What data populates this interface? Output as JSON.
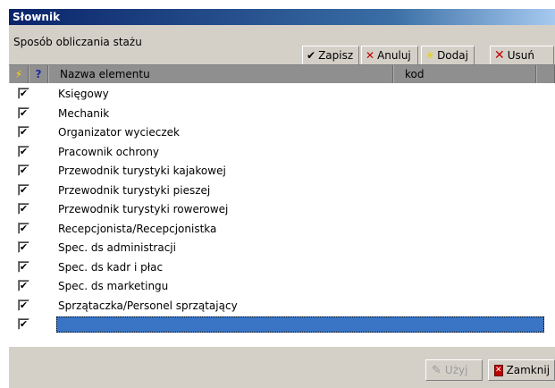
{
  "window": {
    "title": "Słownik"
  },
  "toolbar": {
    "label": "Sposób obliczania stażu",
    "buttons": [
      {
        "label": "Zapisz",
        "icon": "check-icon"
      },
      {
        "label": "Anuluj",
        "icon": "cross-icon"
      },
      {
        "label": "Dodaj",
        "icon": "star-icon"
      },
      {
        "label": "Usuń",
        "icon": "delete-x-icon"
      }
    ]
  },
  "grid": {
    "header": {
      "flag_icon": "lightning-icon",
      "help_icon": "?",
      "col_name": "Nazwa elementu",
      "col_code": "kod"
    },
    "rows": [
      {
        "checked": true,
        "name": "Księgowy"
      },
      {
        "checked": true,
        "name": "Mechanik"
      },
      {
        "checked": true,
        "name": "Organizator wycieczek"
      },
      {
        "checked": true,
        "name": "Pracownik ochrony"
      },
      {
        "checked": true,
        "name": "Przewodnik turystyki kajakowej"
      },
      {
        "checked": true,
        "name": "Przewodnik turystyki pieszej"
      },
      {
        "checked": true,
        "name": "Przewodnik turystyki rowerowej"
      },
      {
        "checked": true,
        "name": "Recepcjonista/Recepcjonistka"
      },
      {
        "checked": true,
        "name": "Spec. ds administracji"
      },
      {
        "checked": true,
        "name": "Spec. ds kadr i płac"
      },
      {
        "checked": true,
        "name": "Spec. ds marketingu"
      },
      {
        "checked": true,
        "name": "Sprzątaczka/Personel sprzątający"
      },
      {
        "checked": true,
        "name": ""
      }
    ],
    "selected_row": 12
  },
  "bottom": {
    "use_label": "Użyj",
    "close_label": "Zamknij"
  },
  "colors": {
    "title_start": "#0a246a",
    "selection": "#3a74c4",
    "face": "#d4d0c8"
  }
}
